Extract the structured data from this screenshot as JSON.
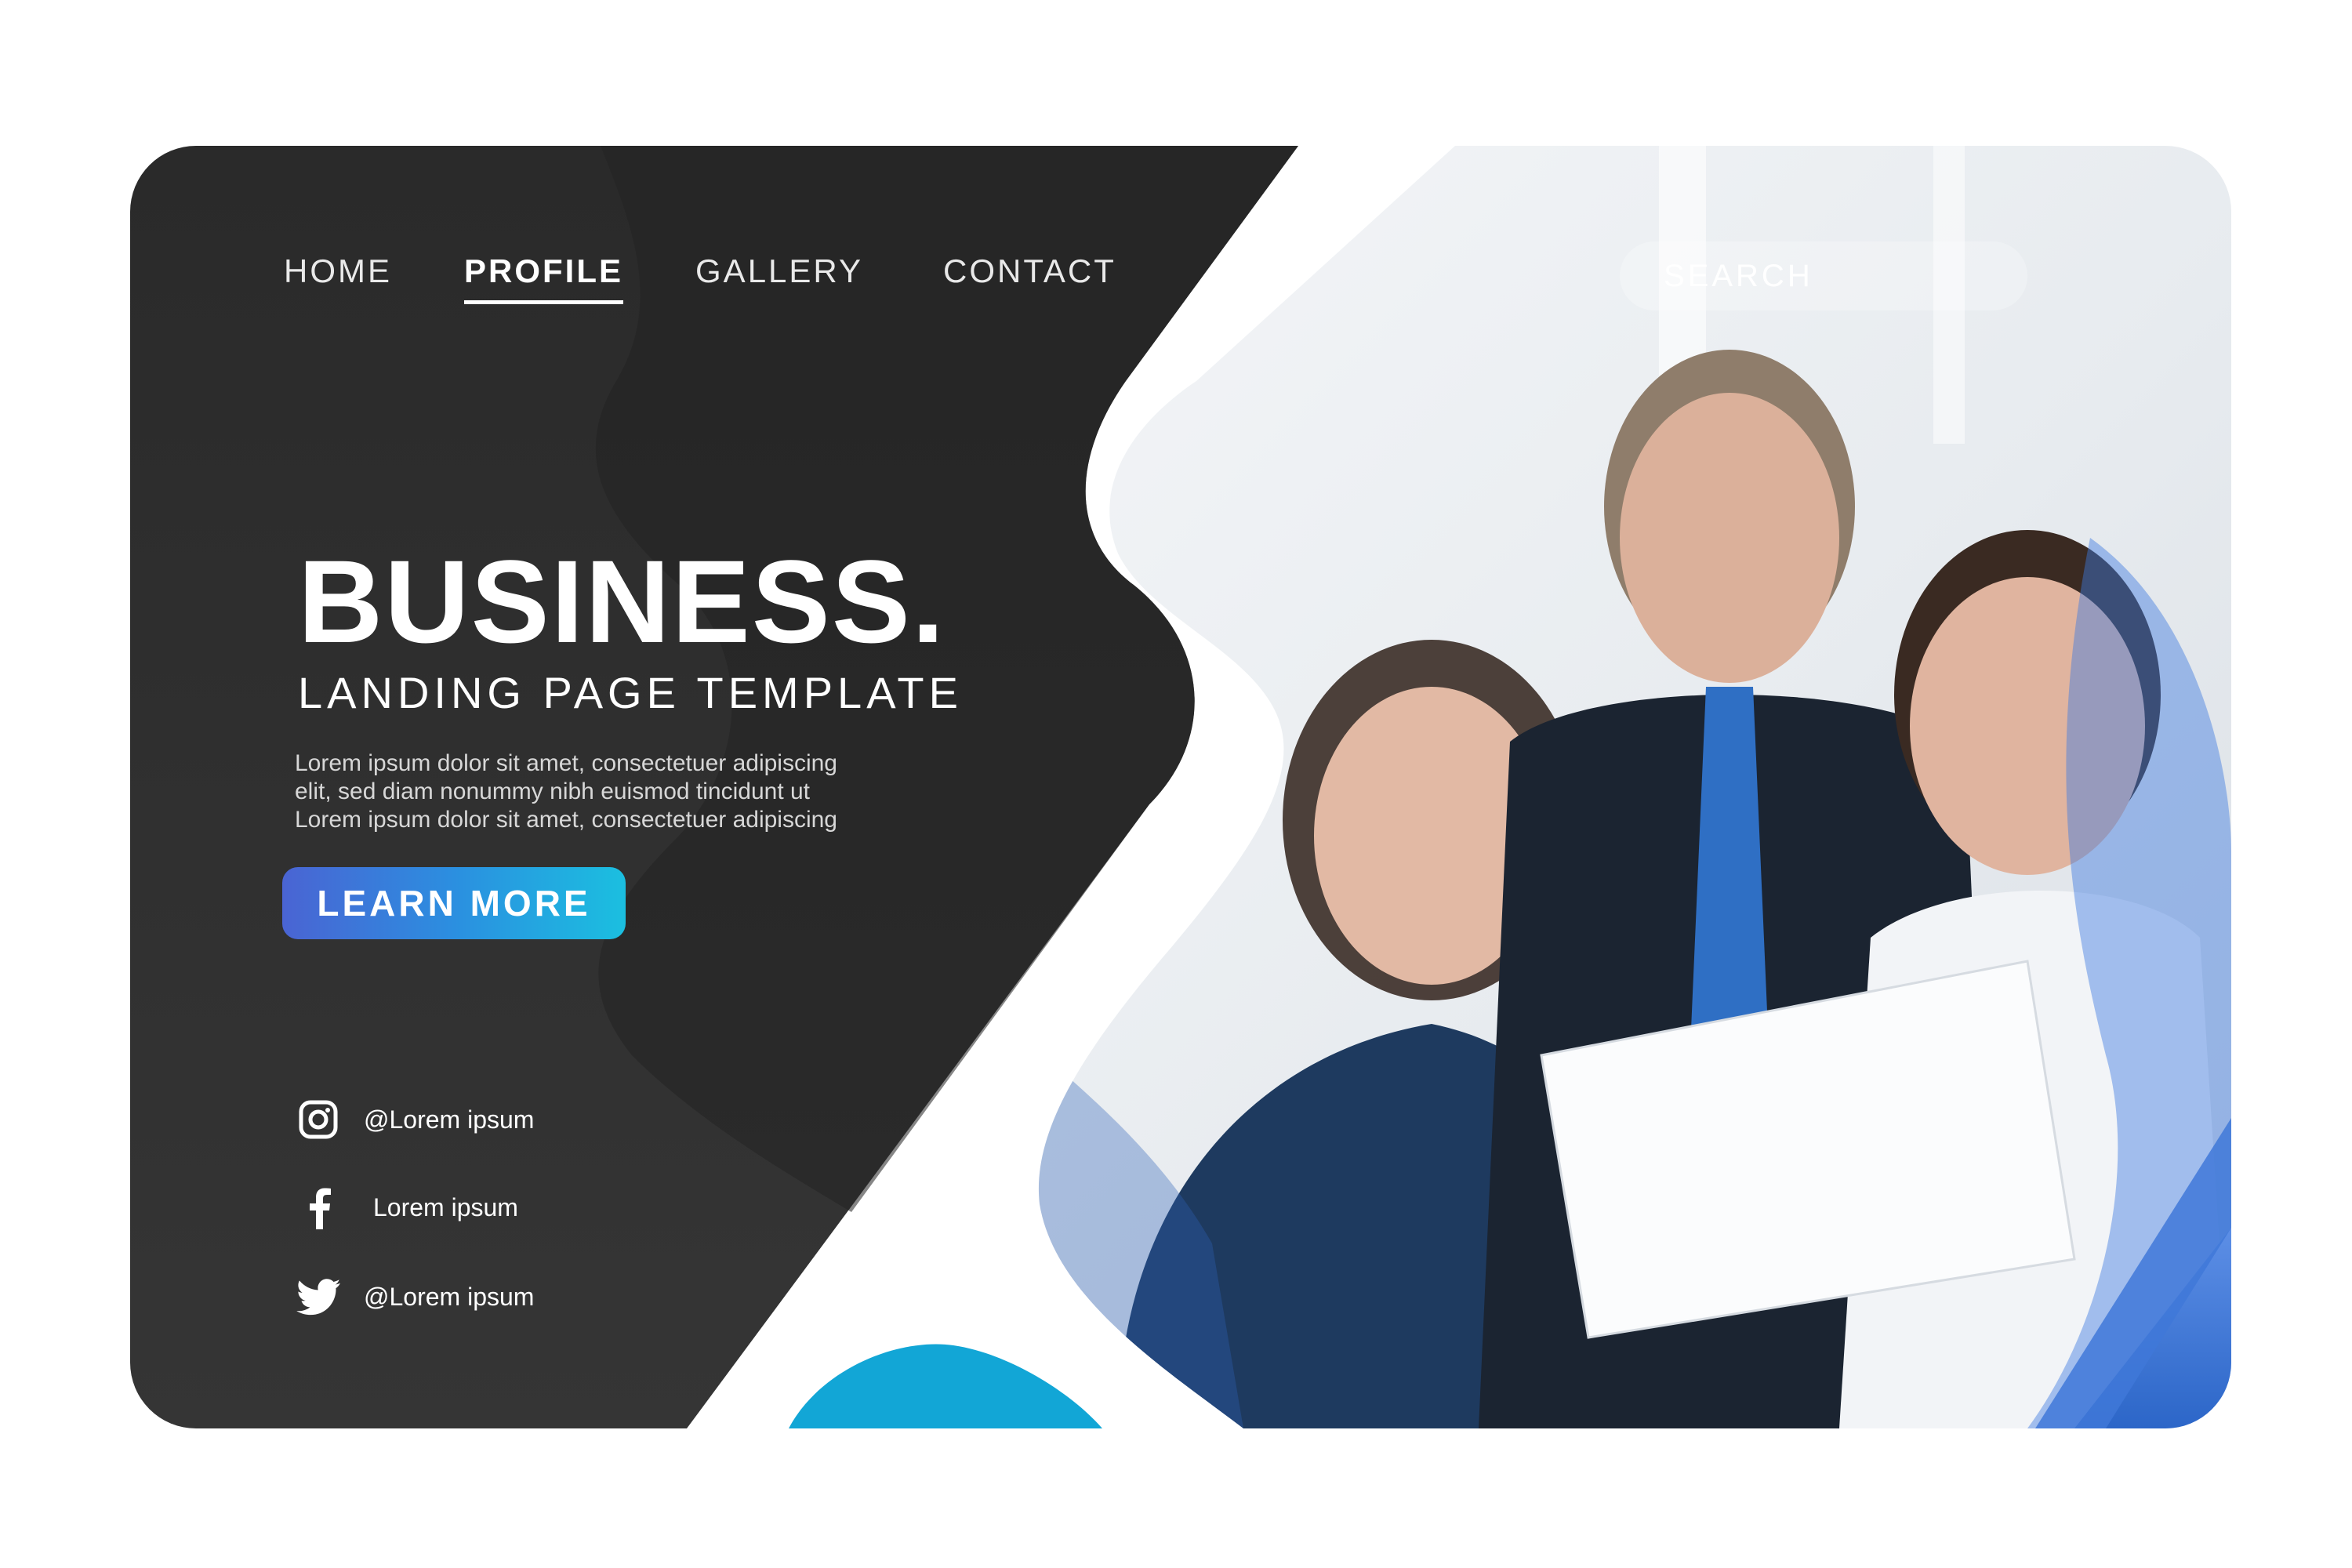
{
  "nav": {
    "items": [
      {
        "label": "HOME"
      },
      {
        "label": "PROFILE",
        "active": true
      },
      {
        "label": "GALLERY"
      },
      {
        "label": "CONTACT"
      }
    ],
    "search_label": "SEARCH"
  },
  "hero": {
    "title": "BUSINESS.",
    "subtitle": "LANDING PAGE TEMPLATE",
    "body": [
      "Lorem ipsum dolor sit amet, consectetuer adipiscing",
      "elit, sed diam nonummy nibh euismod tincidunt ut",
      "Lorem ipsum dolor sit amet, consectetuer adipiscing"
    ],
    "cta_label": "LEARN MORE"
  },
  "social": [
    {
      "icon": "instagram-icon",
      "label": "@Lorem ipsum"
    },
    {
      "icon": "facebook-icon",
      "label": "Lorem ipsum"
    },
    {
      "icon": "twitter-icon",
      "label": "@Lorem ipsum"
    }
  ],
  "colors": {
    "dark_panel": "#2b2b2b",
    "accent_blue": "#3f78d8",
    "accent_cyan": "#1aaee0",
    "white": "#ffffff"
  }
}
